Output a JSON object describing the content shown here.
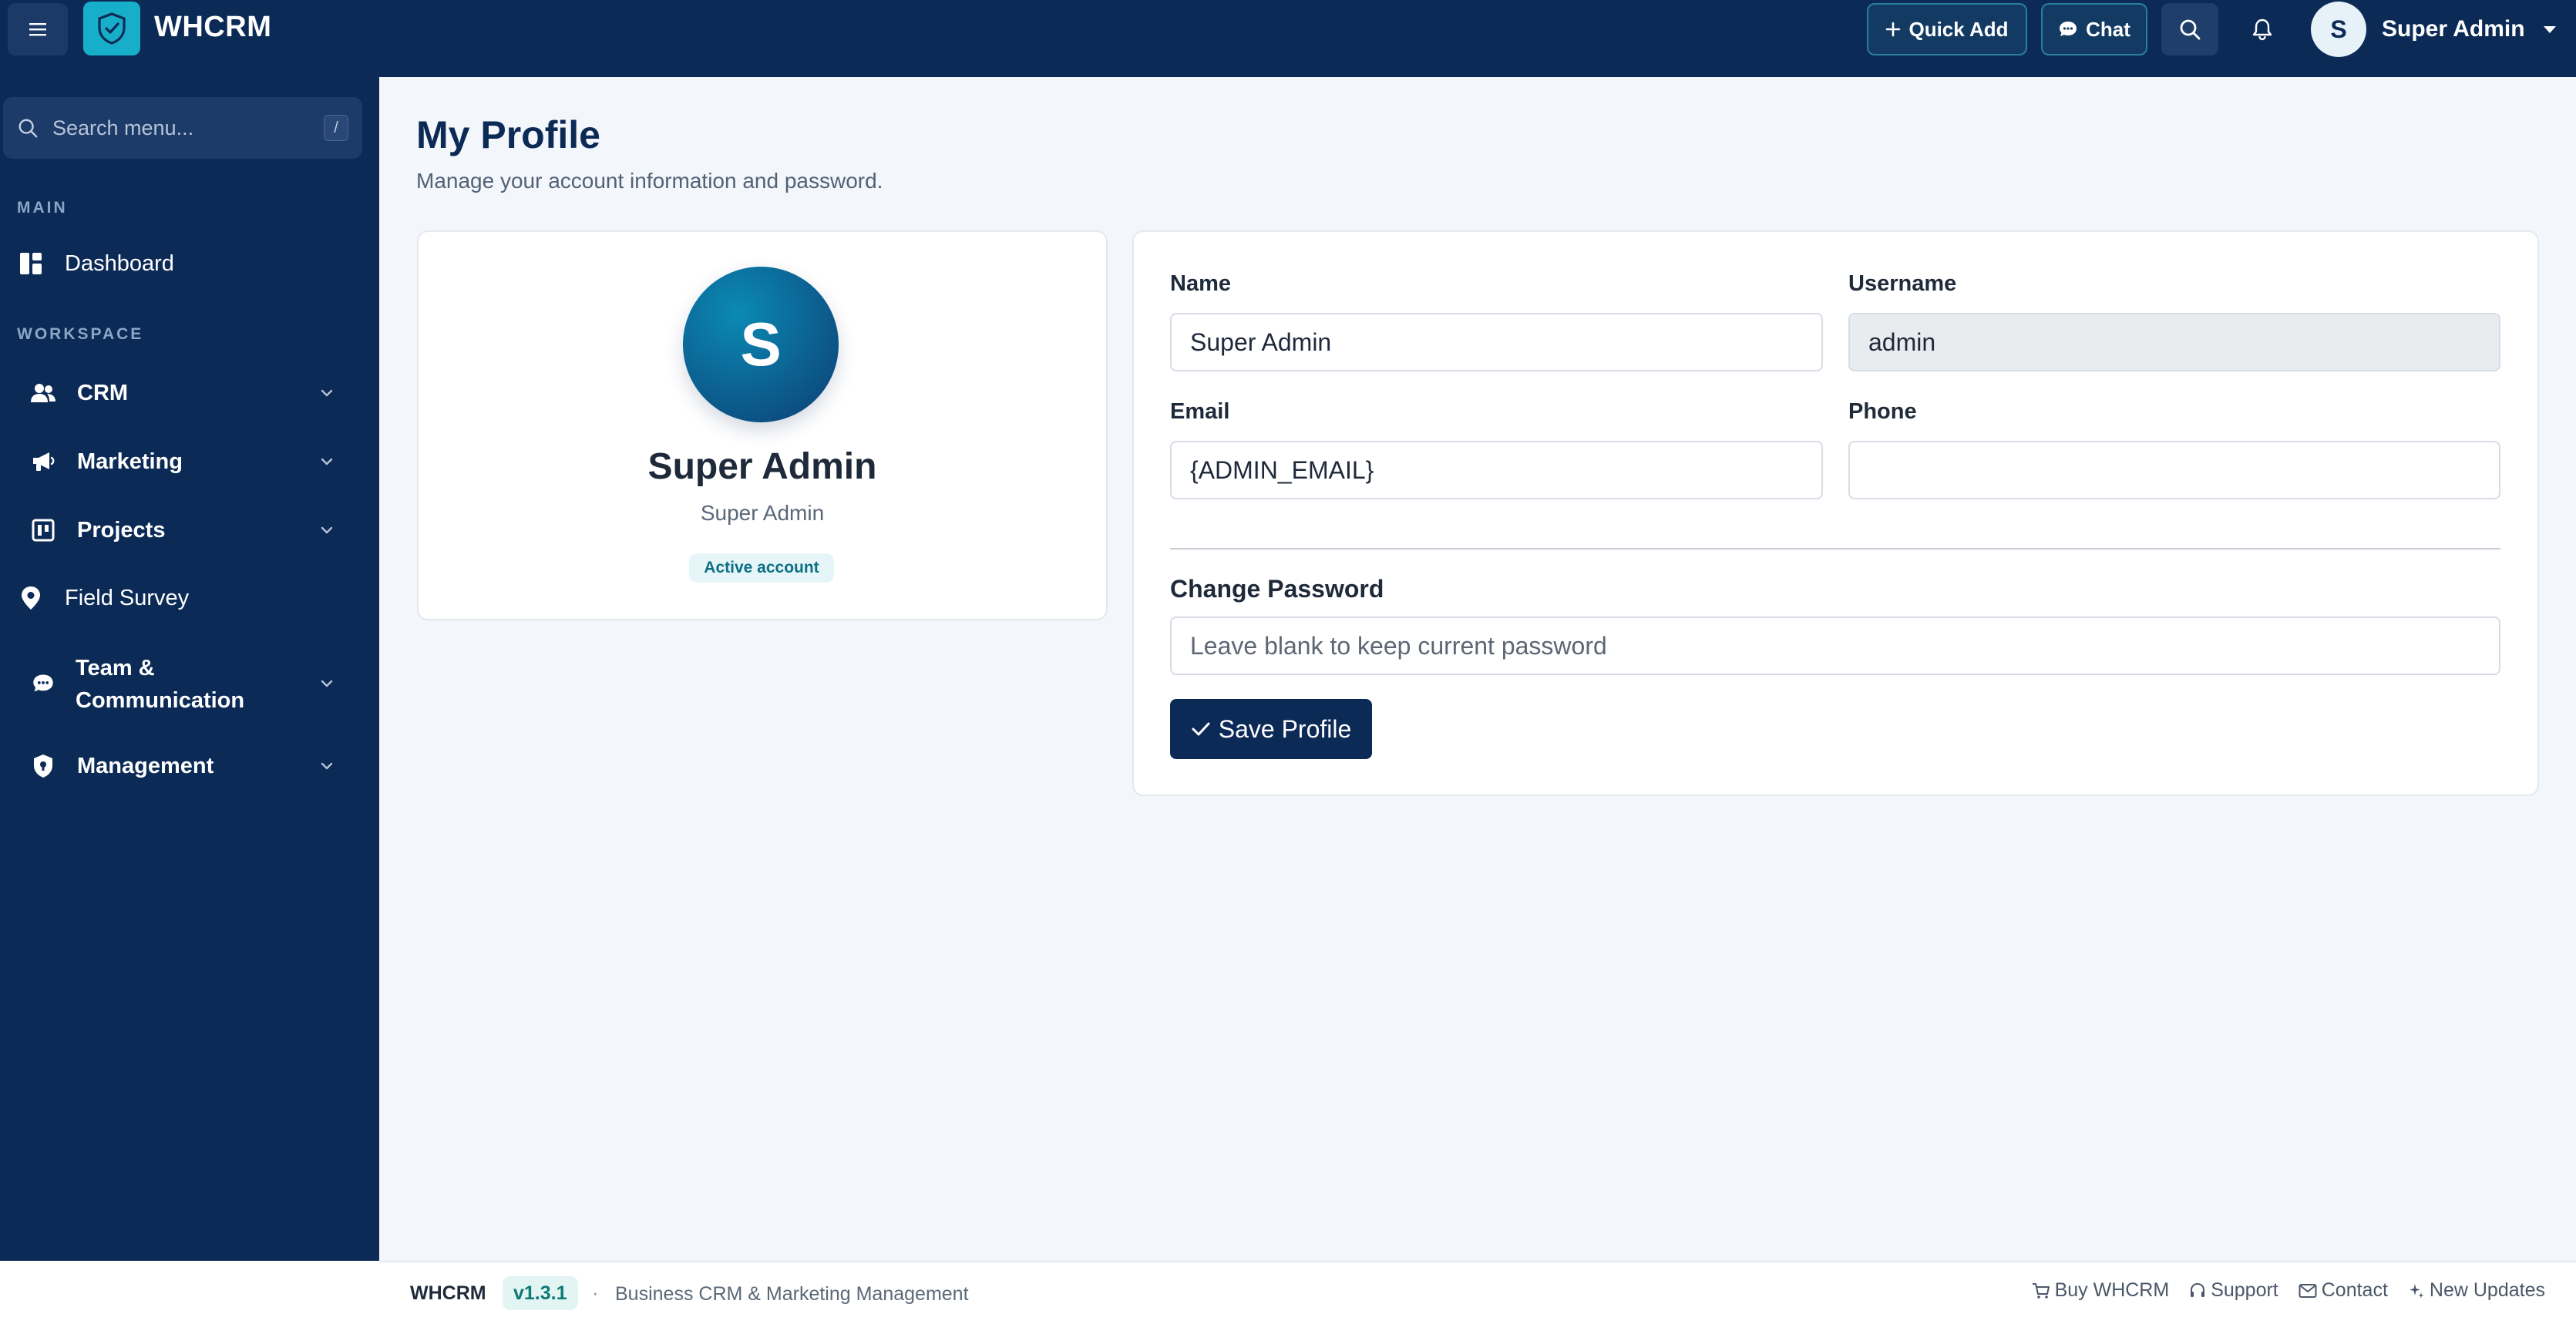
{
  "app": {
    "brand": "WHCRM"
  },
  "topbar": {
    "quick_add": "Quick Add",
    "chat": "Chat",
    "user_initial": "S",
    "user_name": "Super Admin"
  },
  "sidebar": {
    "search_placeholder": "Search menu...",
    "search_shortcut": "/",
    "section_main": "MAIN",
    "section_workspace": "WORKSPACE",
    "items": [
      {
        "label": "Dashboard"
      },
      {
        "label": "CRM"
      },
      {
        "label": "Marketing"
      },
      {
        "label": "Projects"
      },
      {
        "label": "Field Survey"
      },
      {
        "label": "Team &",
        "label2": "Communication"
      },
      {
        "label": "Management"
      }
    ]
  },
  "page": {
    "title": "My Profile",
    "subtitle": "Manage your account information and password."
  },
  "profile_card": {
    "initial": "S",
    "name": "Super Admin",
    "role": "Super Admin",
    "status": "Active account"
  },
  "form": {
    "name_label": "Name",
    "name_value": "Super Admin",
    "username_label": "Username",
    "username_value": "admin",
    "email_label": "Email",
    "email_value": "{ADMIN_EMAIL}",
    "phone_label": "Phone",
    "phone_value": "",
    "change_password_label": "Change Password",
    "password_placeholder": "Leave blank to keep current password",
    "save_label": "Save Profile"
  },
  "footer": {
    "brand": "WHCRM",
    "version": "v1.3.1",
    "separator": "·",
    "description": "Business CRM & Marketing Management",
    "links": [
      "Buy WHCRM",
      "Support",
      "Contact",
      "New Updates"
    ]
  },
  "colors": {
    "navy": "#0c2a56",
    "accent": "#17aec9",
    "page_bg": "#f3f6fa"
  }
}
